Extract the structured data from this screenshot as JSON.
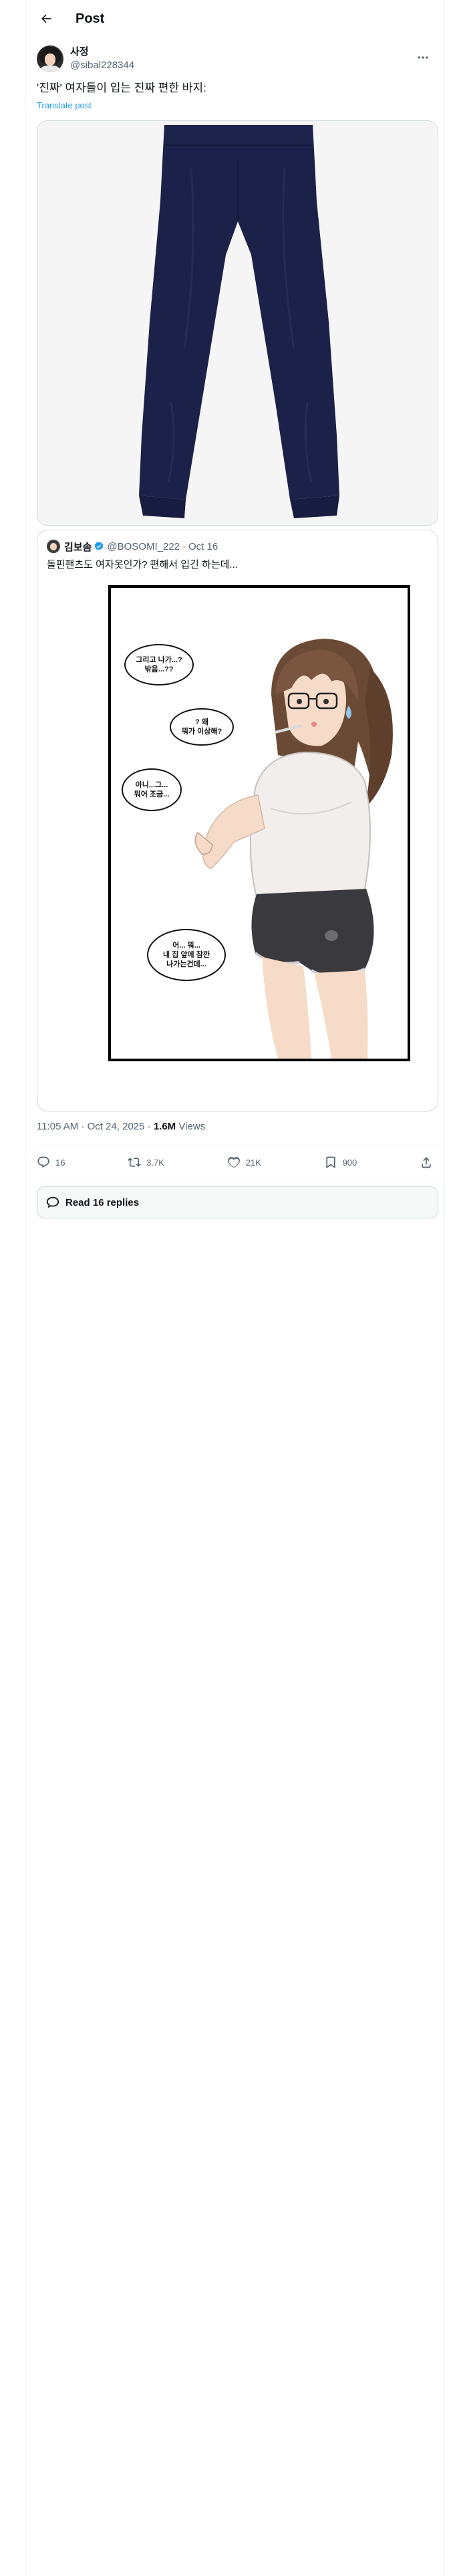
{
  "header": {
    "title": "Post"
  },
  "author": {
    "display_name": "사정",
    "handle": "@sibal228344"
  },
  "post": {
    "text": "'진짜' 여자들이 입는 진짜 편한 바지:",
    "translate_label": "Translate post"
  },
  "quote": {
    "display_name": "김보솜",
    "handle": "@BOSOMI_222",
    "separator": "·",
    "date": "Oct 16",
    "text": "돌핀팬츠도 여자옷인가? 편해서 입긴 하는데...",
    "bubbles": [
      "그리고 나가...?\n밖음...??",
      "? 왜\n뭐가 이상해?",
      "아니...그...\n뭐어 조금...",
      "어... 뭐...\n내 집 앞에 잠깐\n나가는건데..."
    ]
  },
  "meta": {
    "timestamp": "11:05 AM · Oct 24, 2025 · ",
    "views_count": "1.6M",
    "views_label": " Views"
  },
  "actions": {
    "replies": "16",
    "reposts": "3.7K",
    "likes": "21K",
    "bookmarks": "900"
  },
  "read_replies_label": "Read 16 replies",
  "colors": {
    "accent": "#1d9bf0",
    "text": "#0f1419",
    "secondary": "#536471",
    "pants": "#1c2149"
  }
}
